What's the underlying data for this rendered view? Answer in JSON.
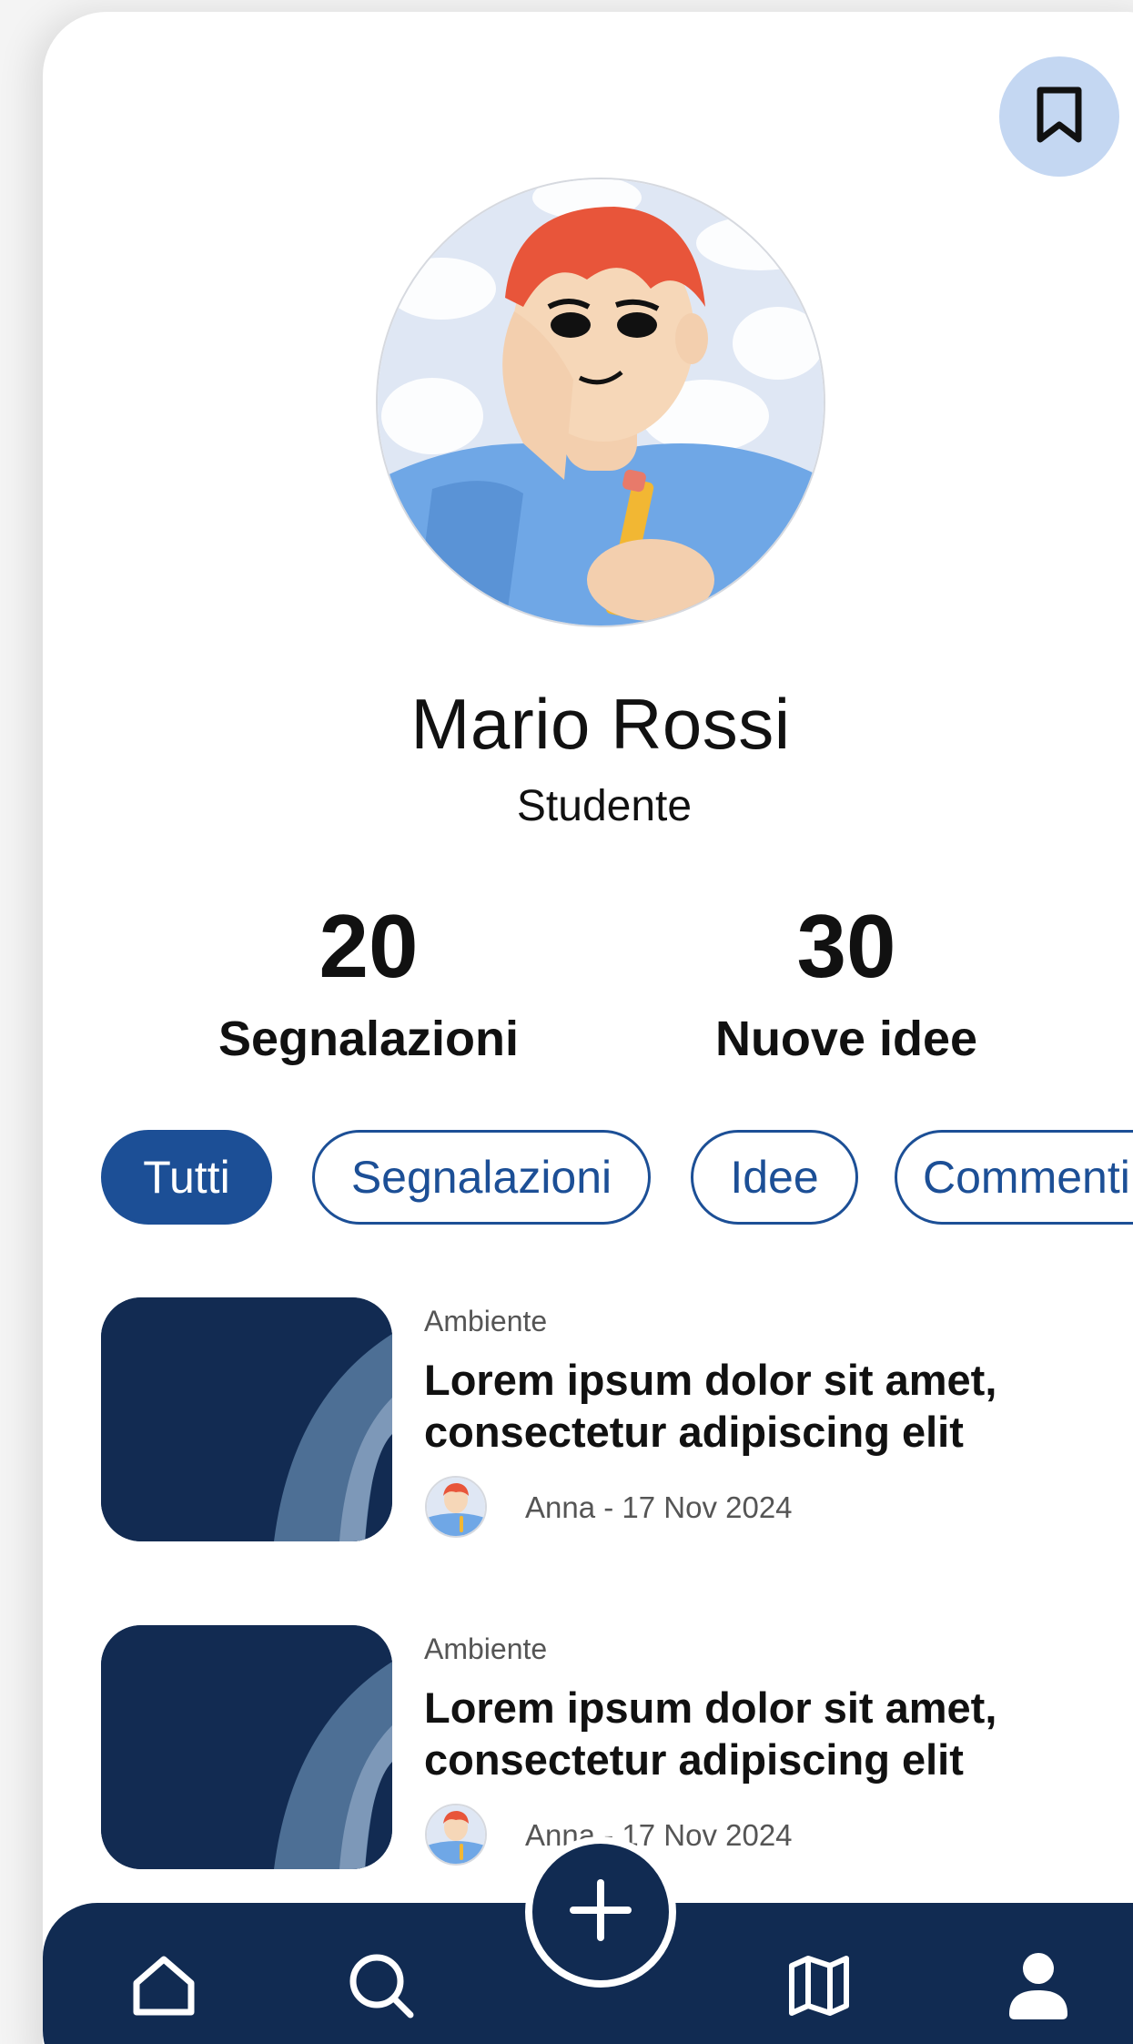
{
  "profile": {
    "name": "Mario Rossi",
    "role": "Studente"
  },
  "stats": [
    {
      "value": "20",
      "label": "Segnalazioni"
    },
    {
      "value": "30",
      "label": "Nuove idee"
    }
  ],
  "filters": [
    {
      "label": "Tutti",
      "active": true
    },
    {
      "label": "Segnalazioni",
      "active": false
    },
    {
      "label": "Idee",
      "active": false
    },
    {
      "label": "Commenti",
      "active": false
    }
  ],
  "feed": [
    {
      "category": "Ambiente",
      "title": "Lorem ipsum dolor sit amet, consectetur adipiscing elit",
      "meta": "Anna - 17 Nov 2024"
    },
    {
      "category": "Ambiente",
      "title": "Lorem ipsum dolor sit amet, consectetur adipiscing elit",
      "meta": "Anna - 17 Nov 2024"
    }
  ],
  "icons": {
    "top_right": "bookmark-icon",
    "nav": [
      "home-icon",
      "search-icon",
      "plus-icon",
      "map-icon",
      "user-icon"
    ]
  },
  "colors": {
    "primary": "#1c4f96",
    "navbar": "#112b52",
    "bookmark_bg": "#c4d7f2",
    "thumb_bg": "#122b52"
  }
}
